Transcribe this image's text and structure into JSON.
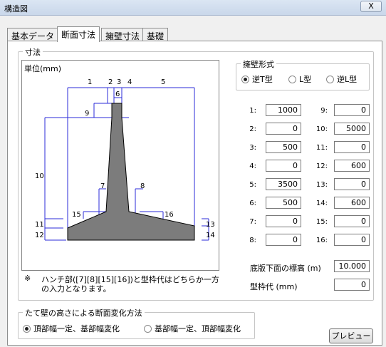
{
  "window": {
    "title": "構造図",
    "close": "X"
  },
  "tabs": [
    "基本データ",
    "断面寸法",
    "擁壁寸法",
    "基礎"
  ],
  "dimensions_group": {
    "title": "寸法"
  },
  "drawing": {
    "unit": "単位(mm)",
    "dim_labels": [
      "1",
      "2",
      "3",
      "4",
      "5",
      "6",
      "7",
      "8",
      "9",
      "10",
      "11",
      "12",
      "13",
      "14",
      "15",
      "16"
    ]
  },
  "note": {
    "symbol": "※",
    "line1": "ハンチ部([7][8][15][16])と型枠代はどちらか一方",
    "line2": "の入力となります。"
  },
  "wall_type": {
    "title": "擁壁形式",
    "options": [
      "逆T型",
      "L型",
      "逆L型"
    ],
    "selected": 0
  },
  "params_left": [
    {
      "label": "1:",
      "value": "1000"
    },
    {
      "label": "2:",
      "value": "0"
    },
    {
      "label": "3:",
      "value": "500"
    },
    {
      "label": "4:",
      "value": "0"
    },
    {
      "label": "5:",
      "value": "3500"
    },
    {
      "label": "6:",
      "value": "500"
    },
    {
      "label": "7:",
      "value": "0"
    },
    {
      "label": "8:",
      "value": "0"
    }
  ],
  "params_right": [
    {
      "label": "9:",
      "value": "0"
    },
    {
      "label": "10:",
      "value": "5000"
    },
    {
      "label": "11:",
      "value": "0"
    },
    {
      "label": "12:",
      "value": "600"
    },
    {
      "label": "13:",
      "value": "0"
    },
    {
      "label": "14:",
      "value": "600"
    },
    {
      "label": "15:",
      "value": "0"
    },
    {
      "label": "16:",
      "value": "0"
    }
  ],
  "bottom_elevation": {
    "label": "底版下面の標高 (m)",
    "value": "10.000"
  },
  "formwork": {
    "label": "型枠代 (mm)",
    "value": "0"
  },
  "section_change": {
    "title": "たて壁の高さによる断面変化方法",
    "options": [
      "頂部幅一定、基部幅変化",
      "基部幅一定、頂部幅変化"
    ],
    "selected": 0
  },
  "preview_button": "プレビュー"
}
